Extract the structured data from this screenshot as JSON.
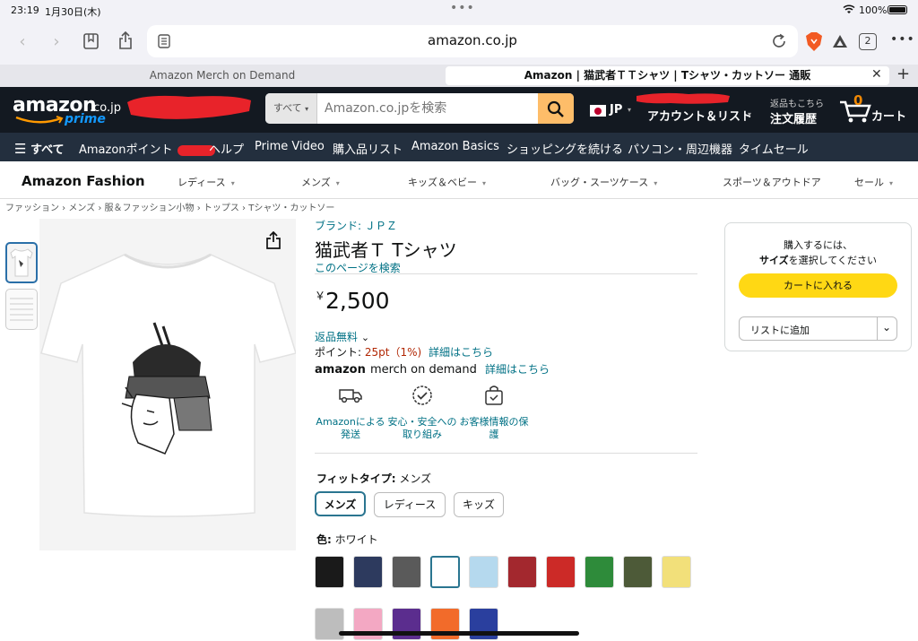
{
  "status_bar": {
    "time": "23:19",
    "date": "1月30日(木)",
    "battery": "100%"
  },
  "browser": {
    "url": "amazon.co.jp",
    "tab_count": "2",
    "tabs": [
      {
        "label": "Amazon Merch on Demand"
      },
      {
        "label": "Amazon | 猫武者ＴＴシャツ | Tシャツ・カットソー 通販"
      }
    ]
  },
  "amazon_nav": {
    "logo_main": "amazon",
    "logo_domain": ".co.jp",
    "logo_prime": "prime",
    "search_category": "すべて",
    "search_placeholder": "Amazon.co.jpを検索",
    "language": "JP",
    "account_label": "アカウント＆リスト",
    "returns_top": "返品もこちら",
    "returns_bottom": "注文履歴",
    "cart_count": "0",
    "cart_label": "カート"
  },
  "sub_nav": {
    "all_label": "すべて",
    "items": [
      "Amazonポイント",
      "ヘルプ",
      "Prime Video",
      "購入品リスト",
      "Amazon Basics",
      "ショッピングを続ける",
      "パソコン・周辺機器",
      "タイムセール"
    ]
  },
  "fashion_bar": {
    "brand": "Amazon Fashion",
    "items": [
      "レディース",
      "メンズ",
      "キッズ＆ベビー",
      "バッグ・スーツケース",
      "スポーツ＆アウトドア",
      "セール"
    ]
  },
  "breadcrumb": "ファッション › メンズ › 服＆ファッション小物 › トップス › Tシャツ・カットソー",
  "product": {
    "brand": "ブランド: ＪＰＺ",
    "title": "猫武者Ｔ Tシャツ",
    "search_page": "このページを検索",
    "currency": "￥",
    "price": "2,500",
    "returns": "返品無料",
    "points_label": "ポイント:",
    "points_value": "25pt（1%)",
    "details_link": "詳細はこちら",
    "merch_logo_amazon": "amazon",
    "merch_logo_text": "merch on demand",
    "merch_details": "詳細はこちら",
    "features": [
      {
        "icon": "truck-icon",
        "label": "Amazonによる発送"
      },
      {
        "icon": "shield-check-icon",
        "label": "安心・安全への取り組み"
      },
      {
        "icon": "lock-bag-icon",
        "label": "お客様情報の保護"
      }
    ],
    "fit_label": "フィットタイプ:",
    "fit_value": "メンズ",
    "fit_options": [
      "メンズ",
      "レディース",
      "キッズ"
    ],
    "color_label": "色:",
    "color_value": "ホワイト",
    "colors_row1": [
      "#1a1a1a",
      "#2d3a5e",
      "#5a5a5a",
      "#ffffff",
      "#b5d9ee",
      "#a3282e",
      "#cc2a27",
      "#2e8b3a",
      "#4d5a38",
      "#f2e07a"
    ],
    "colors_row2": [
      "#bdbdbd",
      "#f3a8c3",
      "#5b2d8e",
      "#f26b2a",
      "#2a3f9e"
    ]
  },
  "buy_box": {
    "line1": "購入するには、",
    "line2_bold": "サイズ",
    "line2_rest": "を選択してください",
    "add_to_cart": "カートに入れる",
    "add_to_list": "リストに追加"
  }
}
